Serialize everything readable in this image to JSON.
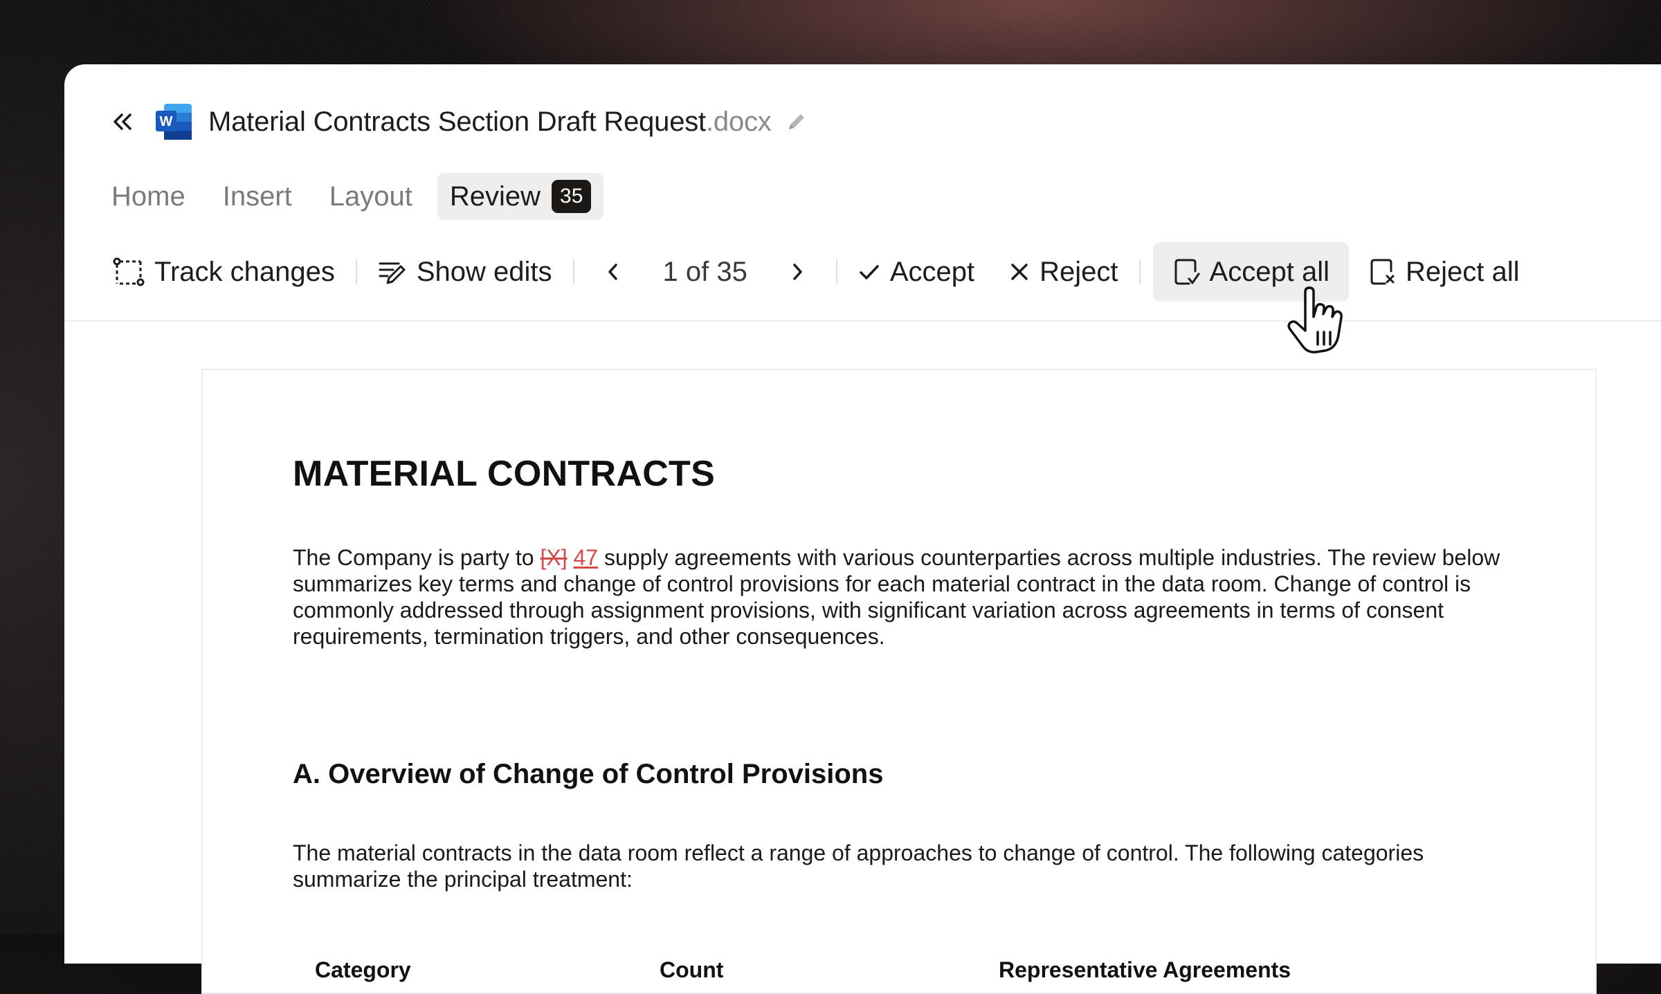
{
  "colors": {
    "accent_change": "#d44a4a",
    "badge_bg": "#1c1816",
    "active_tab_bg": "#efeeec",
    "word_blue": "#185abd"
  },
  "titlebar": {
    "back_icon": "double-chevron-left-icon",
    "app_icon": "word-icon",
    "app_icon_letter": "W",
    "file_name": "Material Contracts Section Draft Request",
    "file_ext": ".docx",
    "edit_icon": "pencil-icon"
  },
  "tabs": [
    {
      "label": "Home",
      "active": false
    },
    {
      "label": "Insert",
      "active": false
    },
    {
      "label": "Layout",
      "active": false
    },
    {
      "label": "Review",
      "active": true,
      "badge": "35"
    }
  ],
  "toolbar": {
    "track_changes": "Track changes",
    "show_edits": "Show edits",
    "counter": "1 of 35",
    "accept": "Accept",
    "reject": "Reject",
    "accept_all": "Accept all",
    "reject_all": "Reject all"
  },
  "document": {
    "title": "MATERIAL CONTRACTS",
    "p1_before": "The Company is party to ",
    "p1_deleted": "[X]",
    "p1_inserted": "47",
    "p1_after": " supply agreements with various counterparties across multiple industries. The review below summarizes key terms and change of control provisions for each material contract in the data room. Change of control is commonly addressed through assignment provisions, with significant variation across agreements in terms of consent requirements, termination triggers, and other consequences.",
    "section_heading": "A. Overview of Change of Control Provisions",
    "p2": "The material contracts in the data room reflect a range of approaches to change of control. The following categories summarize the principal treatment:",
    "table_headers": [
      "Category",
      "Count",
      "Representative Agreements"
    ]
  }
}
